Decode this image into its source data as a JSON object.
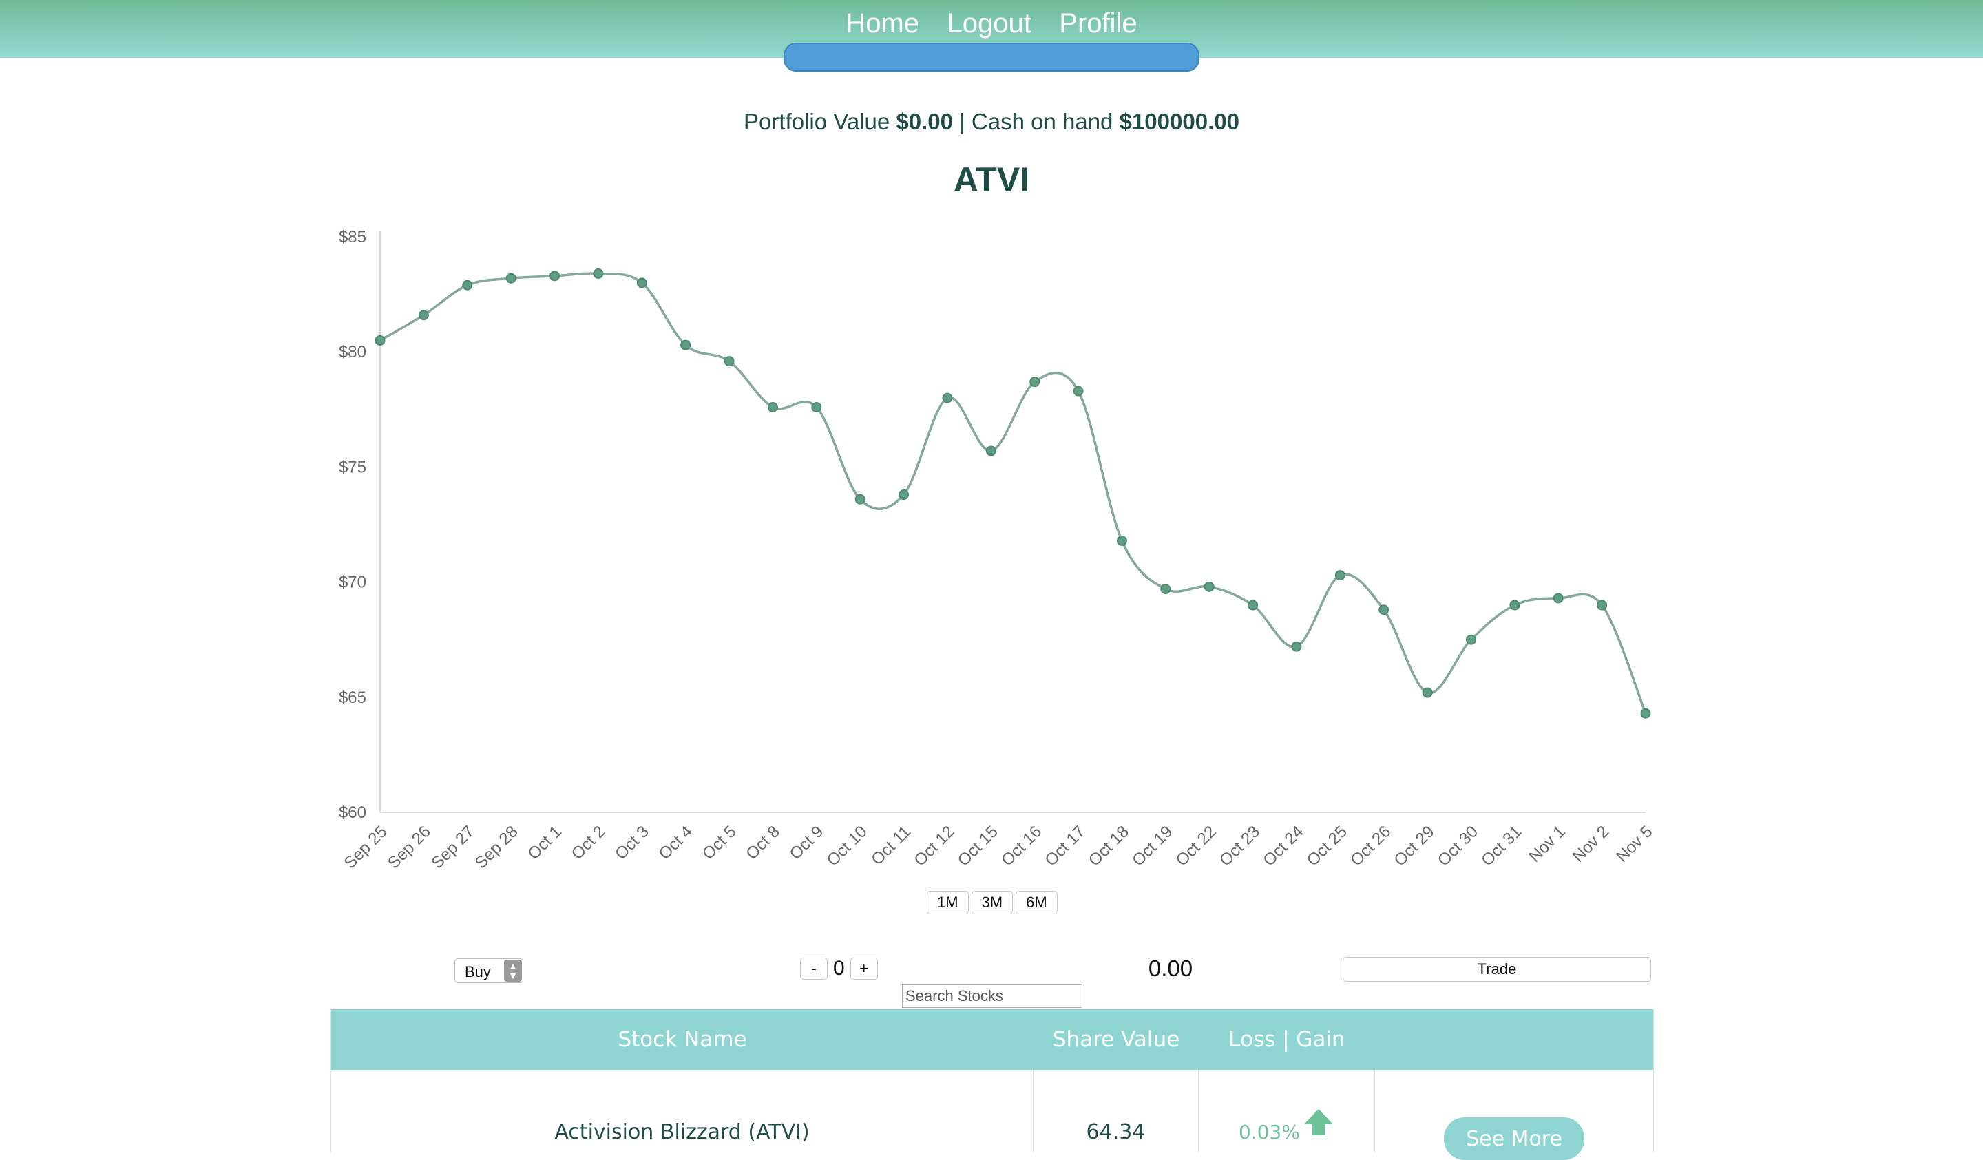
{
  "nav": {
    "home": "Home",
    "logout": "Logout",
    "profile": "Profile"
  },
  "summary": {
    "portfolio_label": "Portfolio Value",
    "portfolio_value": "$0.00",
    "separator": "|",
    "cash_label": "Cash on hand",
    "cash_value": "$100000.00"
  },
  "ticker": "ATVI",
  "range_buttons": [
    "1M",
    "3M",
    "6M"
  ],
  "trade": {
    "action": "Buy",
    "minus": "-",
    "quantity": "0",
    "plus": "+",
    "total": "0.00",
    "button": "Trade",
    "search_placeholder": "Search Stocks"
  },
  "table": {
    "headers": {
      "name": "Stock Name",
      "value": "Share Value",
      "loss_gain": "Loss | Gain"
    },
    "rows": [
      {
        "name": "Activision Blizzard (ATVI)",
        "value": "64.34",
        "change": "0.03%",
        "action": "See More"
      }
    ]
  },
  "chart_data": {
    "type": "line",
    "title": "ATVI",
    "ylim": [
      60,
      85
    ],
    "yticks": [
      "$60",
      "$65",
      "$70",
      "$75",
      "$80",
      "$85"
    ],
    "categories": [
      "Sep 25",
      "Sep 26",
      "Sep 27",
      "Sep 28",
      "Oct 1",
      "Oct 2",
      "Oct 3",
      "Oct 4",
      "Oct 5",
      "Oct 8",
      "Oct 9",
      "Oct 10",
      "Oct 11",
      "Oct 12",
      "Oct 15",
      "Oct 16",
      "Oct 17",
      "Oct 18",
      "Oct 19",
      "Oct 22",
      "Oct 23",
      "Oct 24",
      "Oct 25",
      "Oct 26",
      "Oct 29",
      "Oct 30",
      "Oct 31",
      "Nov 1",
      "Nov 2",
      "Nov 5"
    ],
    "values": [
      80.5,
      81.6,
      82.9,
      83.2,
      83.3,
      83.4,
      83.0,
      80.3,
      79.6,
      77.6,
      77.6,
      73.6,
      73.8,
      78.0,
      75.7,
      78.7,
      78.3,
      71.8,
      69.7,
      69.8,
      69.0,
      67.2,
      70.3,
      68.8,
      65.2,
      67.5,
      69.0,
      69.3,
      69.0,
      64.3
    ],
    "colors": {
      "line": "#84a89a",
      "point": "#5f9e83",
      "axis": "#d9d9d9",
      "tick_label": "#666666"
    },
    "grid": false,
    "legend": "none"
  },
  "colors": {
    "accent": "#8fd6d2",
    "nav_gradient_top": "#6fbc98",
    "nav_pill": "#4f9ed7",
    "text": "#1f4d45",
    "gain": "#6dc29a"
  }
}
